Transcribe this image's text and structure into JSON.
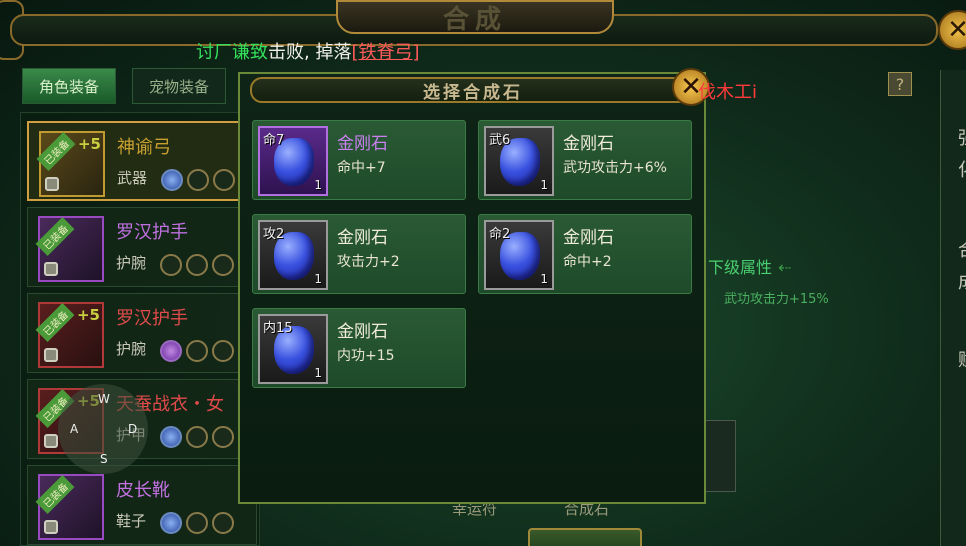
{
  "window": {
    "title": "合成"
  },
  "system_message": {
    "name": "讨厂谦致",
    "middle": "击败, 掉落",
    "item": "[铁脊弓]"
  },
  "tabs": [
    {
      "label": "角色装备",
      "active": true
    },
    {
      "label": "宠物装备",
      "active": false
    }
  ],
  "equipment_list": [
    {
      "name": "神谕弓",
      "type": "武器",
      "plus": "+5",
      "tag": "已装备",
      "name_color": "#c8a030",
      "slots": [
        "blue",
        "empty",
        "empty"
      ]
    },
    {
      "name": "罗汉护手",
      "type": "护腕",
      "plus": "",
      "tag": "已装备",
      "name_color": "#c070e0",
      "slots": [
        "empty",
        "empty",
        "empty"
      ]
    },
    {
      "name": "罗汉护手",
      "type": "护腕",
      "plus": "+5",
      "tag": "已装备",
      "name_color": "#e04a4a",
      "slots": [
        "purple",
        "empty",
        "empty"
      ]
    },
    {
      "name": "天蚕战衣・女",
      "type": "护甲",
      "plus": "+5",
      "tag": "已装备",
      "name_color": "#e04a4a",
      "slots": [
        "blue",
        "empty",
        "empty"
      ]
    },
    {
      "name": "皮长靴",
      "type": "鞋子",
      "plus": "",
      "tag": "已装备",
      "name_color": "#c070e0",
      "slots": [
        "blue",
        "empty",
        "empty"
      ]
    }
  ],
  "wasd": {
    "w": "W",
    "a": "A",
    "s": "S",
    "d": "D"
  },
  "modal": {
    "title": "选择合成石",
    "stones": [
      {
        "level": "命7",
        "name": "金刚石",
        "effect": "命中+7",
        "count": "1",
        "rarity": "purple"
      },
      {
        "level": "武6",
        "name": "金刚石",
        "effect": "武功攻击力+6%",
        "count": "1",
        "rarity": "normal"
      },
      {
        "level": "攻2",
        "name": "金刚石",
        "effect": "攻击力+2",
        "count": "1",
        "rarity": "normal"
      },
      {
        "level": "命2",
        "name": "金刚石",
        "effect": "命中+2",
        "count": "1",
        "rarity": "normal"
      },
      {
        "level": "内15",
        "name": "金刚石",
        "effect": "内功+15",
        "count": "1",
        "rarity": "normal"
      }
    ]
  },
  "background_panel": {
    "overlap_text": "伐木工i",
    "next_attr_label": "下级属性",
    "next_attr_value": "武功攻击力+15%",
    "help": "?",
    "bottom_left_label": "幸运符",
    "bottom_right_label": "合成石",
    "right_edge_chars": [
      "强",
      "化",
      "合",
      "成",
      "赋"
    ]
  },
  "icons": {
    "close": "close-icon",
    "lock": "lock-icon",
    "gem": "diamond-gem-icon",
    "arrow": "arrow-left-icon"
  }
}
